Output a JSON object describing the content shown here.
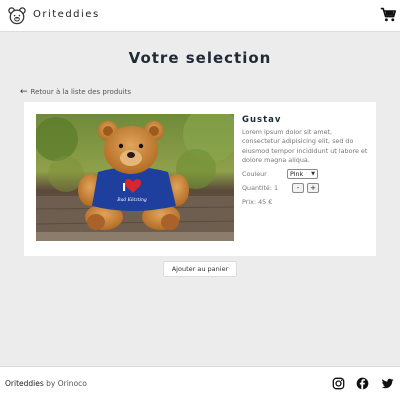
{
  "header": {
    "brand": "Oriteddies",
    "logo_icon": "teddy-face-icon",
    "cart_icon": "shopping-cart-icon"
  },
  "page": {
    "title": "Votre selection",
    "back_link": "Retour à la liste des produits",
    "back_icon": "arrow-left-icon"
  },
  "product": {
    "name": "Gustav",
    "description": "Lorem ipsum dolor sit amet, consectetur adipisicing elit, sed do eiusmod tempor incididunt ut labore et dolore magna aliqua.",
    "color_label": "Couleur",
    "color_selected": "Pink",
    "quantity_label": "Quantité: 1",
    "quantity": 1,
    "decrement": "-",
    "increment": "+",
    "price_label": "Prix: 45 €",
    "shirt_text_line1": "I",
    "shirt_text_line2": "Bad Kötzting"
  },
  "actions": {
    "add_to_cart": "Ajouter au panier"
  },
  "footer": {
    "brand": "Oriteddies",
    "by_text": "by Orinoco",
    "social": [
      "instagram-icon",
      "facebook-icon",
      "twitter-icon"
    ]
  },
  "colors": {
    "background": "#ececec",
    "card": "#ffffff",
    "title": "#1f2a36",
    "text_muted": "#777777",
    "shirt_blue": "#1f3f9e",
    "heart_red": "#d8262c"
  }
}
